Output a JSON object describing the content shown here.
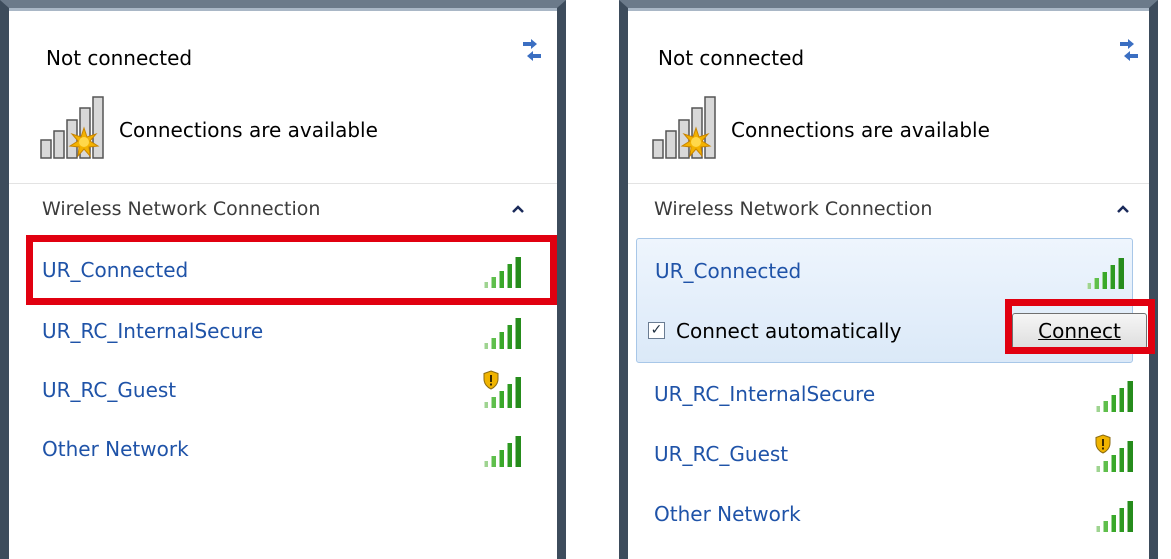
{
  "left_panel": {
    "status_title": "Not connected",
    "availability_text": "Connections are available",
    "section_title": "Wireless Network Connection",
    "networks": [
      {
        "name": "UR_Connected",
        "secured_warning": false
      },
      {
        "name": "UR_RC_InternalSecure",
        "secured_warning": false
      },
      {
        "name": "UR_RC_Guest",
        "secured_warning": true
      },
      {
        "name": "Other Network",
        "secured_warning": false
      }
    ],
    "highlighted_network_index": 0
  },
  "right_panel": {
    "status_title": "Not connected",
    "availability_text": "Connections are available",
    "section_title": "Wireless Network Connection",
    "expanded_network": {
      "name": "UR_Connected",
      "connect_automatically_label": "Connect automatically",
      "connect_automatically_checked": true,
      "connect_button_label": "Connect"
    },
    "networks": [
      {
        "name": "UR_RC_InternalSecure",
        "secured_warning": false
      },
      {
        "name": "UR_RC_Guest",
        "secured_warning": true
      },
      {
        "name": "Other Network",
        "secured_warning": false
      }
    ]
  },
  "icons": {
    "refresh": "refresh-icon",
    "signal_available": "signal-available-icon",
    "collapse": "chevron-up-icon",
    "signal_bars": "signal-bars-icon",
    "security_warning": "shield-warning-icon",
    "checkbox_mark": "✓"
  },
  "colors": {
    "link_blue": "#1f53a8",
    "highlight_red": "#e10010",
    "signal_green": "#35a82a",
    "expanded_bg": "#e4eefa"
  }
}
